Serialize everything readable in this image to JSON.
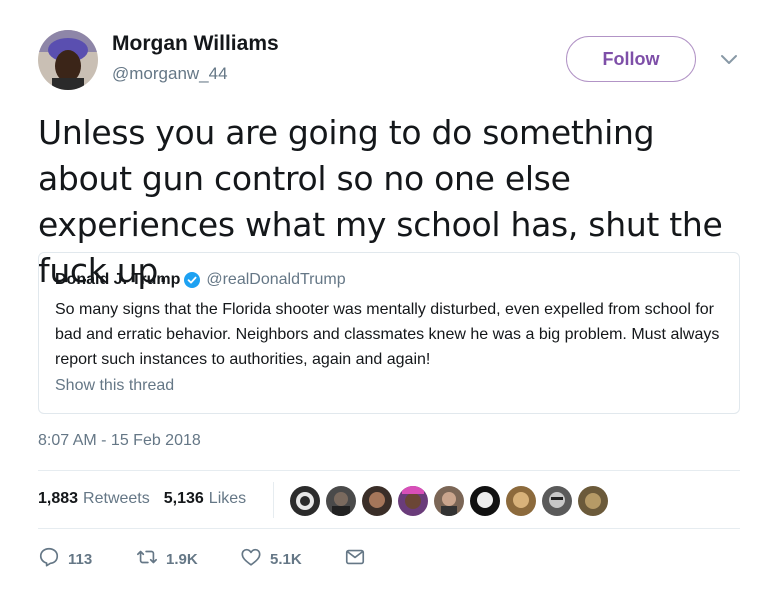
{
  "author": {
    "name": "Morgan Williams",
    "handle": "@morganw_44",
    "follow_label": "Follow"
  },
  "tweet": {
    "text": "Unless you are going to do something about gun control so no one else experiences what my school has, shut the fuck up.",
    "timestamp": "8:07 AM - 15 Feb 2018"
  },
  "quoted": {
    "name": "Donald J. Trump",
    "handle": "@realDonaldTrump",
    "text": "So many signs that the Florida shooter was mentally disturbed, even expelled from school for bad and erratic behavior. Neighbors and classmates knew he was a big problem. Must always report such instances to authorities, again and again!",
    "show_thread": "Show this thread"
  },
  "stats": {
    "retweets_count": "1,883",
    "retweets_label": "Retweets",
    "likes_count": "5,136",
    "likes_label": "Likes"
  },
  "actions": {
    "replies": "113",
    "retweets": "1.9K",
    "likes": "5.1K"
  },
  "colors": {
    "accent": "#7e4fa8",
    "secondary_text": "#657786",
    "verified": "#1da1f2"
  }
}
